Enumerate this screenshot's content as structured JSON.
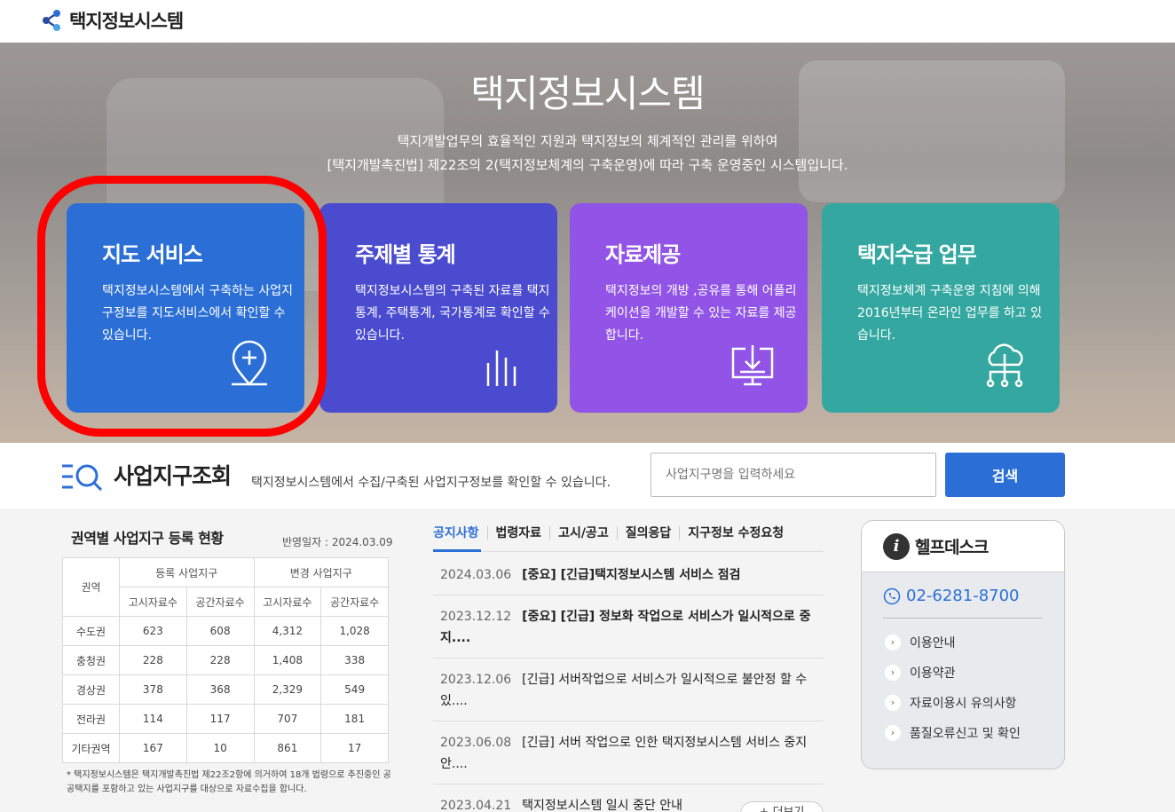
{
  "header": {
    "site_title": "택지정보시스템"
  },
  "hero": {
    "title": "택지정보시스템",
    "desc_line1": "택지개발업무의 효율적인 지원과 택지정보의 체계적인 관리를 위하여",
    "desc_line2": "[택지개발촉진법] 제22조의 2(택지정보체계의 구축운영)에 따라 구축 운영중인 시스템입니다."
  },
  "cards": [
    {
      "title": "지도 서비스",
      "desc": "택지정보시스템에서 구축하는 사업지구정보를 지도서비스에서 확인할 수 있습니다.",
      "icon": "map-pin-plus-icon",
      "color": "#2b6fd6"
    },
    {
      "title": "주제별 통계",
      "desc": "택지정보시스템의 구축된 자료를 택지통계, 주택통계, 국가통계로 확인할 수 있습니다.",
      "icon": "bar-chart-icon",
      "color": "#4a4bcf"
    },
    {
      "title": "자료제공",
      "desc": "택지정보의 개방 ,공유를 통해 어플리케이션을 개발할 수 있는 자료를 제공합니다.",
      "icon": "download-monitor-icon",
      "color": "#9154e6"
    },
    {
      "title": "택지수급 업무",
      "desc": "택지정보체계 구축운영 지침에 의해 2016년부터 온라인 업무를 하고 있습니다.",
      "icon": "cloud-network-icon",
      "color": "#34a8a0"
    }
  ],
  "search": {
    "title": "사업지구조회",
    "desc": "택지정보시스템에서 수집/구축된 사업지구정보를 확인할 수 있습니다.",
    "placeholder": "사업지구명을 입력하세요",
    "button": "검색"
  },
  "stats": {
    "title": "권역별 사업지구 등록 현황",
    "date": "반영일자 : 2024.03.09",
    "head_region": "권역",
    "head_group1": "등록 사업지구",
    "head_group2": "변경 사업지구",
    "sub_notice": "고시자료수",
    "sub_spatial": "공간자료수",
    "rows": [
      [
        "수도권",
        "623",
        "608",
        "4,312",
        "1,028"
      ],
      [
        "충청권",
        "228",
        "228",
        "1,408",
        "338"
      ],
      [
        "경상권",
        "378",
        "368",
        "2,329",
        "549"
      ],
      [
        "전라권",
        "114",
        "117",
        "707",
        "181"
      ],
      [
        "기타권역",
        "167",
        "10",
        "861",
        "17"
      ]
    ],
    "note": "* 택지정보시스템은 택지개발촉진법 제22조2항에 의거하여 18개 법령으로 추진중인 공공택지를 포함하고 있는 사업지구를 대상으로 자료수집을 합니다."
  },
  "notices": {
    "tabs": [
      "공지사항",
      "법령자료",
      "고시/공고",
      "질의응답",
      "지구정보 수정요청"
    ],
    "items": [
      {
        "date": "2024.03.06",
        "title": "[중요] [긴급]택지정보시스템 서비스 점검",
        "bold": true
      },
      {
        "date": "2023.12.12",
        "title": "[중요] [긴급] 정보화 작업으로 서비스가 일시적으로 중지....",
        "bold": true
      },
      {
        "date": "2023.12.06",
        "title": "[긴급] 서버작업으로 서비스가 일시적으로 불안정 할 수 있....",
        "bold": false
      },
      {
        "date": "2023.06.08",
        "title": "[긴급] 서버 작업으로 인한 택지정보시스템 서비스 중지 안....",
        "bold": false
      },
      {
        "date": "2023.04.21",
        "title": "택지정보시스템 일시 중단 안내",
        "bold": false
      }
    ],
    "more": "+ 더보기"
  },
  "helpdesk": {
    "title": "헬프데스크",
    "phone": "02-6281-8700",
    "links": [
      "이용안내",
      "이용약관",
      "자료이용시 유의사항",
      "품질오류신고 및 확인"
    ]
  }
}
